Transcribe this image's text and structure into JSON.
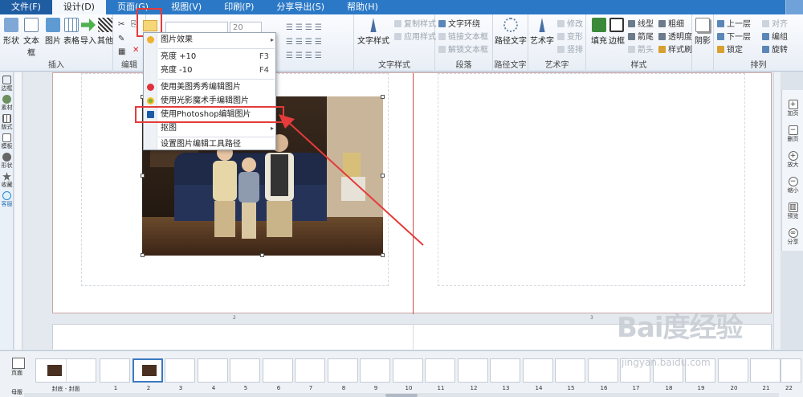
{
  "menu": {
    "items": [
      "文件(F)",
      "设计(D)",
      "页面(G)",
      "视图(V)",
      "印刷(P)",
      "分享导出(S)",
      "帮助(H)"
    ],
    "active_index": 1
  },
  "ribbon": {
    "insert_group": {
      "buttons": [
        "形状",
        "文本框",
        "图片",
        "表格",
        "导入",
        "其他"
      ],
      "label": "插入"
    },
    "edit_group_label": "编辑",
    "font_size": "20",
    "text_style_group": {
      "big_button": "文字样式",
      "items": [
        "复制样式",
        "应用样式"
      ],
      "label": "文字样式"
    },
    "paragraph_group": {
      "items": [
        "文字环绕",
        "链接文本框",
        "解锁文本框"
      ],
      "label": "段落"
    },
    "path_text_group": {
      "button": "路径文字",
      "label": "路径文字"
    },
    "art_text_group": {
      "button": "艺术字",
      "items": [
        "修改",
        "变形",
        "竖排"
      ],
      "label": "艺术字"
    },
    "style_group": {
      "buttons": [
        "填充",
        "边框"
      ],
      "items": [
        "线型",
        "粗细",
        "箭尾",
        "透明度",
        "箭头",
        "样式刷"
      ],
      "label": "样式"
    },
    "shadow_button": "阴影",
    "arrange_group": {
      "items": [
        "上一层",
        "对齐",
        "下一层",
        "编组",
        "锁定",
        "旋转"
      ],
      "label": "排列"
    }
  },
  "dropdown": {
    "title": "图片效果",
    "items": [
      {
        "label": "亮度 +10",
        "shortcut": "F3"
      },
      {
        "label": "亮度 -10",
        "shortcut": "F4"
      },
      {
        "label": "使用美图秀秀编辑图片",
        "shortcut": ""
      },
      {
        "label": "使用光影魔术手编辑图片",
        "shortcut": ""
      },
      {
        "label": "使用Photoshop编辑图片",
        "shortcut": ""
      },
      {
        "label": "抠图",
        "shortcut": ""
      },
      {
        "label": "设置图片编辑工具路径",
        "shortcut": ""
      }
    ]
  },
  "left_sidebar": [
    "边框",
    "素材",
    "版式",
    "模板",
    "形状",
    "收藏",
    "客服"
  ],
  "right_panel": [
    "加页",
    "删页",
    "放大",
    "缩小",
    "预览",
    "分享"
  ],
  "canvas": {
    "page_numbers": [
      "2",
      "3"
    ]
  },
  "thumbnails": {
    "labels": [
      "封底 - 封面",
      "1",
      "2",
      "3",
      "4",
      "5",
      "6",
      "7",
      "8",
      "9",
      "10",
      "11",
      "12",
      "13",
      "14",
      "15",
      "16",
      "17",
      "18",
      "19",
      "20",
      "21",
      "22"
    ],
    "left_label_top": "页面",
    "left_label_bottom": "母版"
  },
  "watermark": {
    "brand": "Bai度经验",
    "url": "jingyan.baidu.com"
  },
  "colors": {
    "menubar": "#2b79c6",
    "highlight_red": "#e53b3b",
    "accent_blue": "#3b78c2"
  }
}
